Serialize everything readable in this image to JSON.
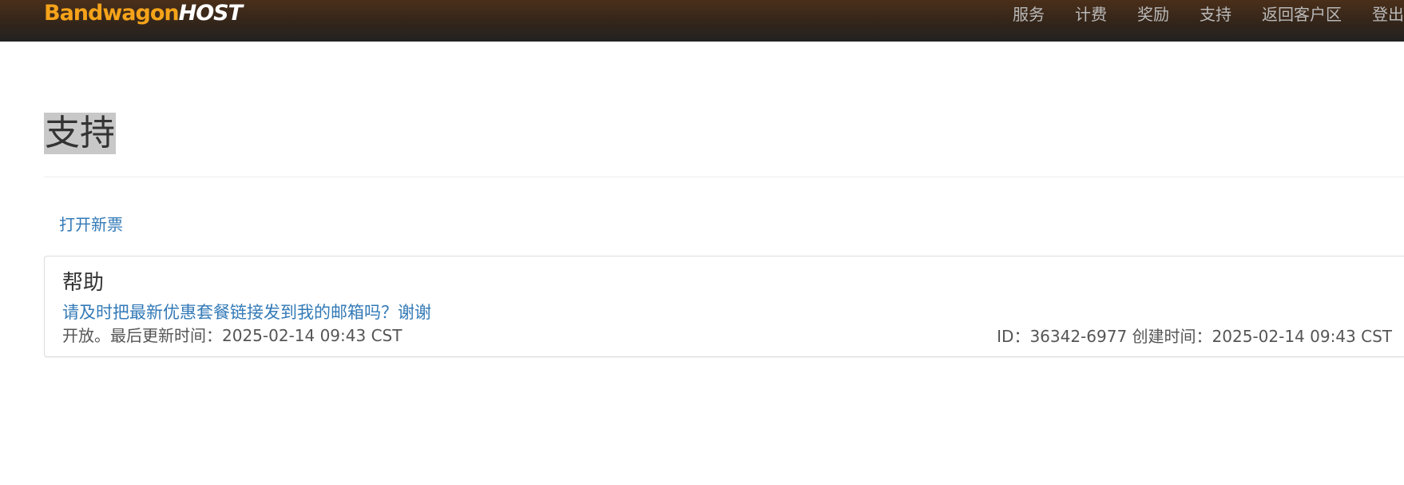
{
  "brand": {
    "part1": "Bandwagon",
    "part2": "HOST"
  },
  "nav": {
    "items": [
      {
        "label": "服务"
      },
      {
        "label": "计费"
      },
      {
        "label": "奖励"
      },
      {
        "label": "支持"
      },
      {
        "label": "返回客户区"
      },
      {
        "label": "登出"
      }
    ]
  },
  "page": {
    "title": "支持",
    "open_ticket_label": "打开新票"
  },
  "ticket": {
    "department": "帮助",
    "subject": "请及时把最新优惠套餐链接发到我的邮箱吗？谢谢",
    "status_line": "开放。最后更新时间：2025-02-14 09:43 CST",
    "meta_line": "ID：36342-6977 创建时间：2025-02-14 09:43 CST"
  },
  "colors": {
    "link": "#337ab7",
    "brand_orange": "#f5a31a",
    "navbar_dark": "#33251a"
  }
}
